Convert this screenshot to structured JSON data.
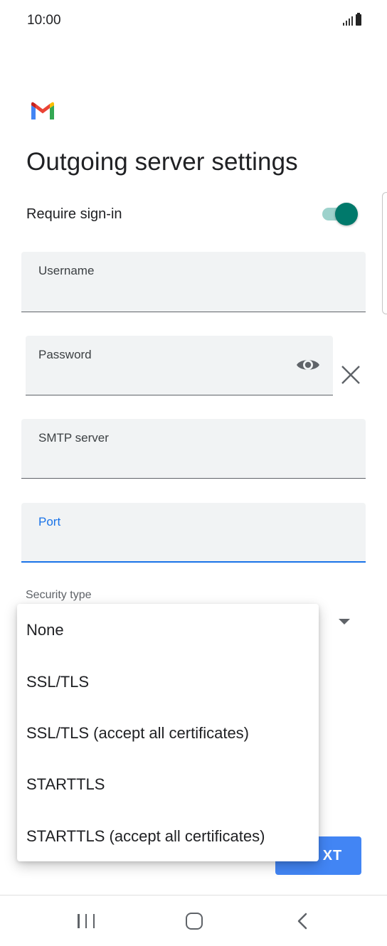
{
  "status_bar": {
    "time": "10:00",
    "icons": [
      "signal-icon",
      "battery-icon"
    ]
  },
  "header": {
    "logo_icon": "gmail-logo",
    "title": "Outgoing server settings"
  },
  "require_signin": {
    "label": "Require sign-in",
    "enabled": true,
    "accent_color": "#00796b"
  },
  "fields": {
    "username": {
      "label": "Username",
      "value": ""
    },
    "password": {
      "label": "Password",
      "value": "",
      "visibility_icon": "eye-icon",
      "clear_icon": "close-icon"
    },
    "smtp_server": {
      "label": "SMTP server",
      "value": ""
    },
    "port": {
      "label": "Port",
      "value": "",
      "focused": true,
      "focus_color": "#1a73e8"
    }
  },
  "security_type": {
    "label": "Security type",
    "options": [
      "None",
      "SSL/TLS",
      "SSL/TLS (accept all certificates)",
      "STARTTLS",
      "STARTTLS (accept all certificates)"
    ]
  },
  "next_button": {
    "visible_text": "XT",
    "color": "#4285f4"
  },
  "nav_bar": {
    "icons": [
      "recents-icon",
      "home-icon",
      "back-icon"
    ]
  }
}
